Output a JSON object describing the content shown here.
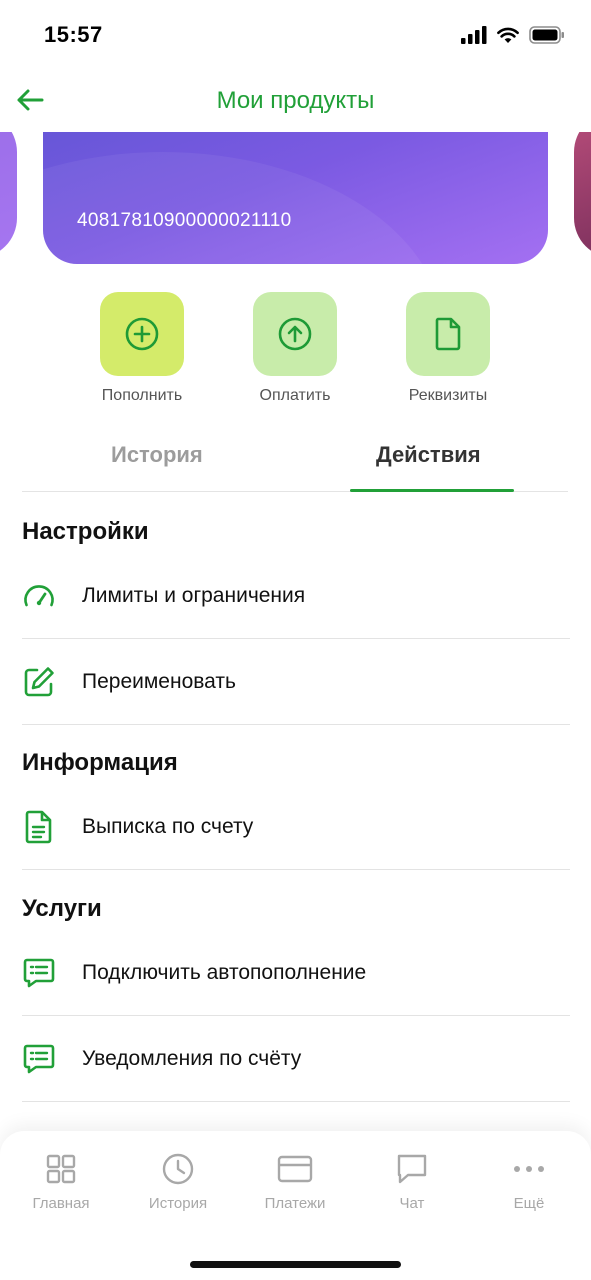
{
  "status_bar": {
    "time": "15:57"
  },
  "header": {
    "title": "Мои продукты"
  },
  "card": {
    "number": "40817810900000021110"
  },
  "actions": [
    {
      "label": "Пополнить",
      "icon": "plus-circle-icon"
    },
    {
      "label": "Оплатить",
      "icon": "arrow-up-circle-icon"
    },
    {
      "label": "Реквизиты",
      "icon": "document-icon"
    }
  ],
  "tabs": [
    {
      "label": "История",
      "active": false
    },
    {
      "label": "Действия",
      "active": true
    }
  ],
  "sections": [
    {
      "title": "Настройки",
      "items": [
        {
          "label": "Лимиты и ограничения",
          "icon": "speedometer-icon"
        },
        {
          "label": "Переименовать",
          "icon": "edit-icon"
        }
      ]
    },
    {
      "title": "Информация",
      "items": [
        {
          "label": "Выписка по счету",
          "icon": "statement-document-icon"
        }
      ]
    },
    {
      "title": "Услуги",
      "items": [
        {
          "label": "Подключить автопополнение",
          "icon": "message-list-icon"
        },
        {
          "label": "Уведомления по счёту",
          "icon": "message-list-icon"
        }
      ]
    }
  ],
  "bottom_nav": [
    {
      "label": "Главная",
      "icon": "grid-icon"
    },
    {
      "label": "История",
      "icon": "clock-icon"
    },
    {
      "label": "Платежи",
      "icon": "card-icon"
    },
    {
      "label": "Чат",
      "icon": "chat-bubble-icon"
    },
    {
      "label": "Ещё",
      "icon": "more-dots-icon"
    }
  ],
  "colors": {
    "accent": "#21a038",
    "tile_active": "#d4eb6a",
    "tile": "#c8ecaa",
    "inactive": "#a8a8a8"
  }
}
